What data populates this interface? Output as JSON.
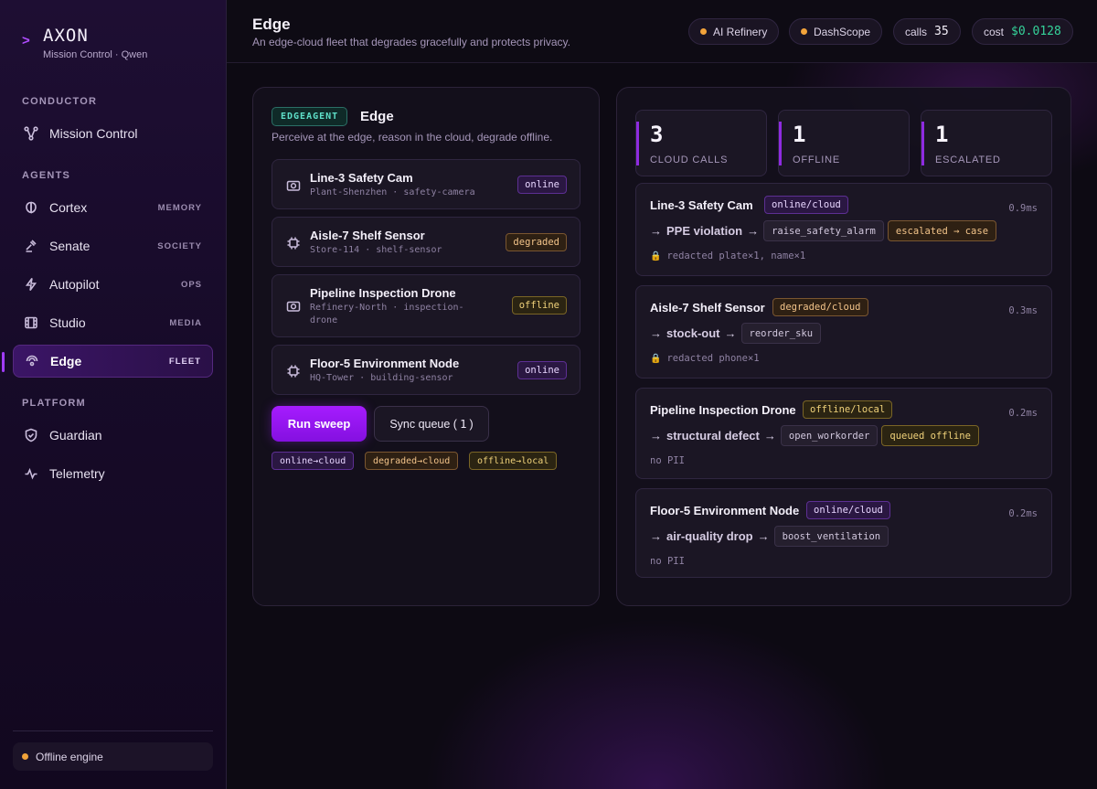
{
  "brand": {
    "title": "AXON",
    "subtitle": "Mission Control · Qwen",
    "chevron": ">"
  },
  "sidebar": {
    "sections": {
      "conductor": "CONDUCTOR",
      "agents": "AGENTS",
      "platform": "PLATFORM"
    },
    "items": [
      {
        "label": "Mission Control",
        "tag": "",
        "icon": "network-icon"
      },
      {
        "label": "Cortex",
        "tag": "MEMORY",
        "icon": "brain-icon"
      },
      {
        "label": "Senate",
        "tag": "SOCIETY",
        "icon": "gavel-icon"
      },
      {
        "label": "Autopilot",
        "tag": "OPS",
        "icon": "lightning-icon"
      },
      {
        "label": "Studio",
        "tag": "MEDIA",
        "icon": "film-icon"
      },
      {
        "label": "Edge",
        "tag": "FLEET",
        "icon": "edge-icon",
        "active": true
      },
      {
        "label": "Guardian",
        "tag": "",
        "icon": "shield-icon"
      },
      {
        "label": "Telemetry",
        "tag": "",
        "icon": "pulse-icon"
      }
    ],
    "engine_status": "Offline engine"
  },
  "header": {
    "title": "Edge",
    "subtitle": "An edge-cloud fleet that degrades gracefully and protects privacy.",
    "chips": {
      "refinery": "AI Refinery",
      "dashscope": "DashScope",
      "calls_label": "calls",
      "calls_value": "35",
      "cost_label": "cost",
      "cost_value": "$0.0128"
    }
  },
  "agent_panel": {
    "badge": "EDGEAGENT",
    "title": "Edge",
    "description": "Perceive at the edge, reason in the cloud, degrade offline.",
    "devices": [
      {
        "name": "Line-3 Safety Cam",
        "location": "Plant-Shenzhen · safety-camera",
        "status": "online",
        "icon": "camera-icon"
      },
      {
        "name": "Aisle-7 Shelf Sensor",
        "location": "Store-114 · shelf-sensor",
        "status": "degraded",
        "icon": "chip-icon"
      },
      {
        "name": "Pipeline Inspection Drone",
        "location": "Refinery-North · inspection-drone",
        "status": "offline",
        "icon": "camera-icon"
      },
      {
        "name": "Floor-5 Environment Node",
        "location": "HQ-Tower · building-sensor",
        "status": "online",
        "icon": "chip-icon"
      }
    ],
    "run_button": "Run sweep",
    "sync_label": "Sync queue (",
    "sync_count": "1",
    "sync_close": ")",
    "routes": [
      "online→cloud",
      "degraded→cloud",
      "offline→local"
    ]
  },
  "stats": [
    {
      "value": "3",
      "label": "CLOUD CALLS"
    },
    {
      "value": "1",
      "label": "OFFLINE"
    },
    {
      "value": "1",
      "label": "ESCALATED"
    }
  ],
  "events": [
    {
      "device": "Line-3 Safety Cam",
      "route": "online/cloud",
      "latency": "0.9ms",
      "finding": "PPE violation",
      "action": "raise_safety_alarm",
      "result": "escalated → case",
      "pii": "redacted plate×1, name×1",
      "pii_locked": true
    },
    {
      "device": "Aisle-7 Shelf Sensor",
      "route": "degraded/cloud",
      "latency": "0.3ms",
      "finding": "stock-out",
      "action": "reorder_sku",
      "result": "",
      "pii": "redacted phone×1",
      "pii_locked": true
    },
    {
      "device": "Pipeline Inspection Drone",
      "route": "offline/local",
      "latency": "0.2ms",
      "finding": "structural defect",
      "action": "open_workorder",
      "result": "queued offline",
      "pii": "no PII",
      "pii_locked": false
    },
    {
      "device": "Floor-5 Environment Node",
      "route": "online/cloud",
      "latency": "0.2ms",
      "finding": "air-quality drop",
      "action": "boost_ventilation",
      "result": "",
      "pii": "no PII",
      "pii_locked": false
    }
  ],
  "colors": {
    "accent": "#a23cff",
    "online": "#e8d6ff",
    "degraded": "#f3c48a",
    "offline": "#f0d27a",
    "cost": "#35d39a",
    "status_dot": "#f2a33a"
  }
}
